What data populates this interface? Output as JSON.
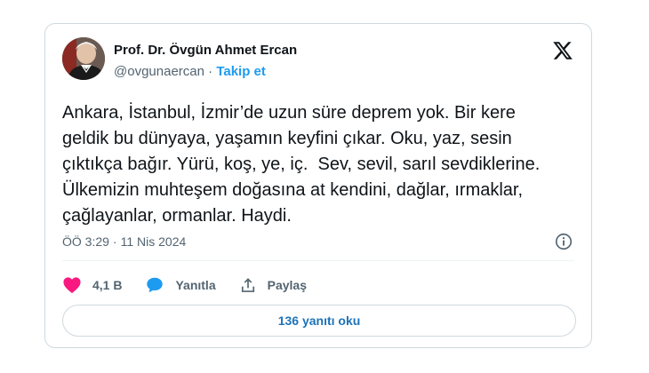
{
  "tweet": {
    "author": {
      "name": "Prof. Dr. Övgün Ahmet Ercan",
      "handle": "@ovgunaercan",
      "separator": "·",
      "follow_label": "Takip et"
    },
    "text": "Ankara, İstanbul, İzmir’de uzun süre deprem yok. Bir kere\ngeldik bu dünyaya, yaşamın keyfini çıkar. Oku, yaz, sesin\nçıktıkça bağır. Yürü, koş, ye, iç.  Sev, sevil, sarıl sevdiklerine.\nÜlkemizin muhteşem doğasına at kendini, dağlar, ırmaklar,\nçağlayanlar, ormanlar. Haydi.",
    "time": "ÖÖ 3:29",
    "date_separator": "·",
    "date": "11 Nis 2024",
    "actions": {
      "likes": "4,1 B",
      "reply_label": "Yanıtla",
      "share_label": "Paylaş"
    },
    "read_replies_label": "136 yanıtı oku"
  },
  "icons": {
    "logo": "x-logo-icon",
    "info": "info-icon",
    "like": "heart-icon",
    "reply": "speech-bubble-icon",
    "share": "share-icon"
  },
  "colors": {
    "accent": "#1d9bf0",
    "like": "#f91880",
    "muted": "#536471",
    "border": "#cfd9de",
    "replies_text": "#1d73b9"
  }
}
